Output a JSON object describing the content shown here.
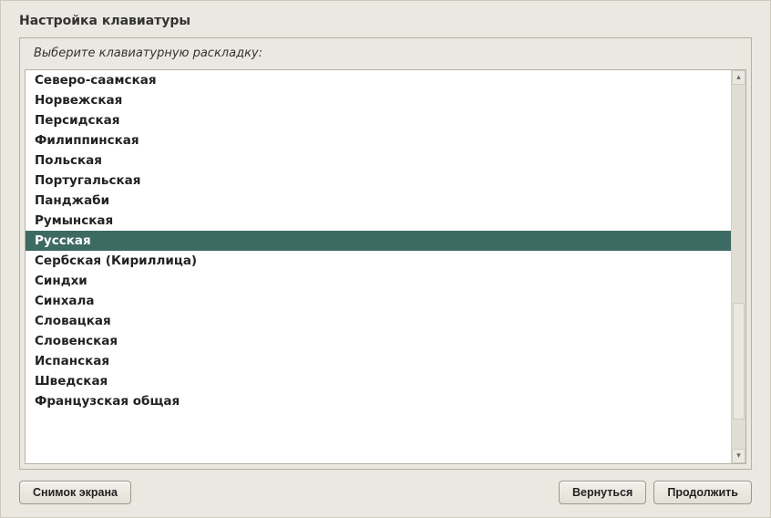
{
  "title": "Настройка клавиатуры",
  "instruction": "Выберите клавиатурную раскладку:",
  "layouts": [
    {
      "label": "Северо-саамская",
      "selected": false
    },
    {
      "label": "Норвежская",
      "selected": false
    },
    {
      "label": "Персидская",
      "selected": false
    },
    {
      "label": "Филиппинская",
      "selected": false
    },
    {
      "label": "Польская",
      "selected": false
    },
    {
      "label": "Португальская",
      "selected": false
    },
    {
      "label": "Панджаби",
      "selected": false
    },
    {
      "label": "Румынская",
      "selected": false
    },
    {
      "label": "Русская",
      "selected": true
    },
    {
      "label": "Сербская (Кириллица)",
      "selected": false
    },
    {
      "label": "Синдхи",
      "selected": false
    },
    {
      "label": "Синхала",
      "selected": false
    },
    {
      "label": "Словацкая",
      "selected": false
    },
    {
      "label": "Словенская",
      "selected": false
    },
    {
      "label": "Испанская",
      "selected": false
    },
    {
      "label": "Шведская",
      "selected": false
    },
    {
      "label": "Французская общая",
      "selected": false
    }
  ],
  "buttons": {
    "screenshot": "Снимок экрана",
    "back": "Вернуться",
    "continue": "Продолжить"
  },
  "scrollbar": {
    "up": "▴",
    "down": "▾"
  }
}
